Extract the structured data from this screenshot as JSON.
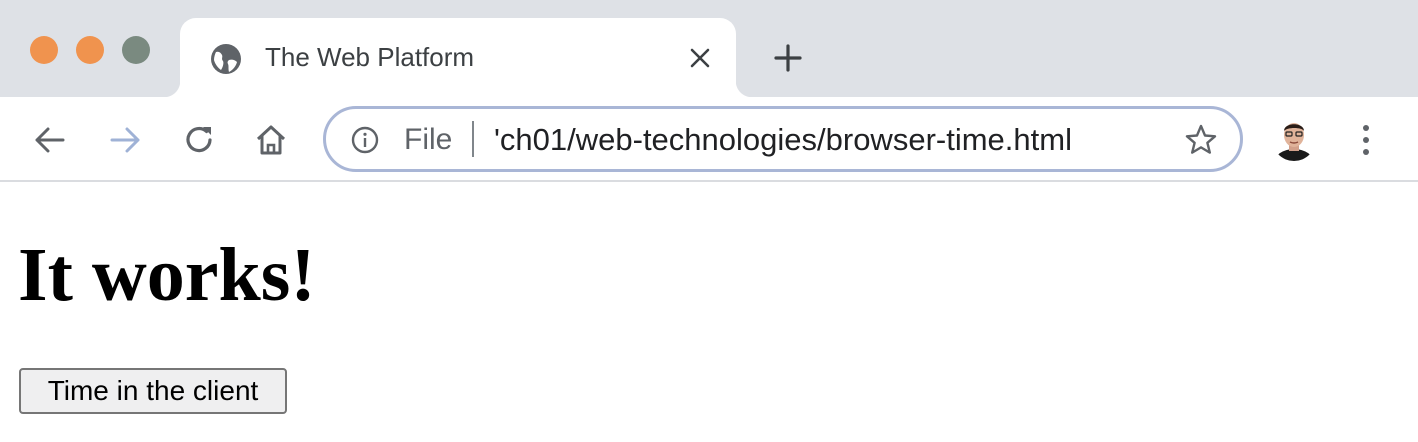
{
  "window": {
    "traffic_lights": {
      "close_color": "#f0934e",
      "minimize_color": "#f0934e",
      "maximize_color": "#7a8a80"
    }
  },
  "tab": {
    "title": "The Web Platform",
    "favicon": "globe-icon",
    "close_icon": "close-icon"
  },
  "new_tab": {
    "icon": "plus-icon"
  },
  "toolbar": {
    "back_icon": "arrow-left-icon",
    "forward_icon": "arrow-right-icon",
    "reload_icon": "reload-icon",
    "home_icon": "home-icon",
    "omnibox": {
      "info_icon": "info-icon",
      "scheme_label": "File",
      "url": "'ch01/web-technologies/browser-time.html",
      "bookmark_icon": "star-icon"
    },
    "profile_icon": "avatar",
    "menu_icon": "kebab-menu-icon"
  },
  "page": {
    "heading": "It works!",
    "button_label": "Time in the client"
  },
  "colors": {
    "tabstrip_bg": "#dee1e6",
    "omnibox_border": "#a9b6d6"
  }
}
